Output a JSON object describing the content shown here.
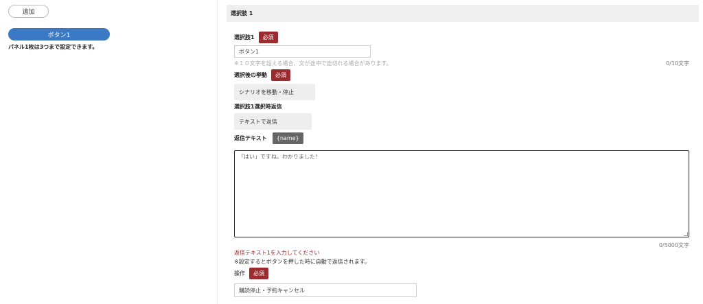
{
  "left": {
    "add_button": "追加",
    "choice_button": "ボタン1",
    "note": "パネル1枚は3つまで設定できます。"
  },
  "panel": {
    "header": "選択肢 1",
    "choice_label": "選択肢1",
    "required": "必須",
    "choice_value": "ボタン1",
    "choice_hint": "※１０文字を超える場合、文が途中で途切れる場合があります。",
    "choice_counter": "0/10文字",
    "action_label": "選択後の挙動",
    "action_value": "シナリオを移動・停止",
    "reply_label": "選択肢1選択時返信",
    "reply_value": "テキストで返信",
    "reply_text_label": "返信テキスト",
    "name_var": "{name}",
    "reply_text_value": "「はい」ですね。わかりました！",
    "reply_counter": "0/5000文字",
    "error": "返信テキスト1を入力してください",
    "note": "※設定するとボタンを押した時に自動で返信されます。",
    "operation_label": "操作",
    "operation_value": "購読停止・予約キャンセル"
  },
  "colors": {
    "accent_blue": "#3b79c4",
    "required_red": "#9a2b2e",
    "error_red": "#a22a2a",
    "variable_gray": "#666666"
  }
}
